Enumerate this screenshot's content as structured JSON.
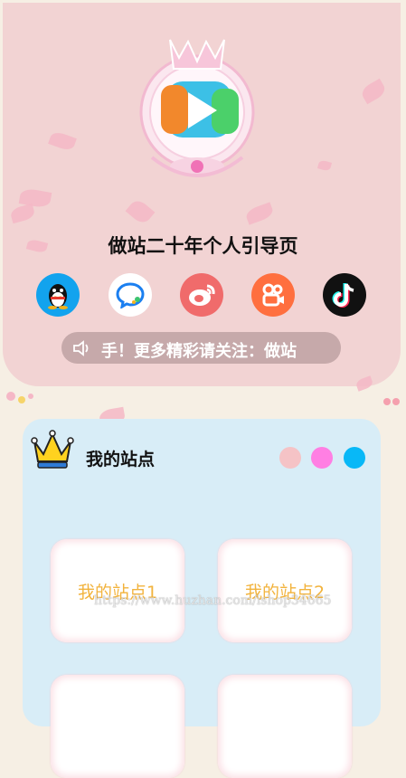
{
  "header": {
    "title": "做站二十年个人引导页",
    "logo_icon": "video-player-logo-icon"
  },
  "social": [
    {
      "name": "qq",
      "icon": "qq-penguin-icon",
      "color": "#12a3ee"
    },
    {
      "name": "chat",
      "icon": "chat-bubble-icon",
      "color": "#ffffff"
    },
    {
      "name": "weibo",
      "icon": "weibo-icon",
      "color": "#f06b6b"
    },
    {
      "name": "kuaishou",
      "icon": "kuaishou-camera-icon",
      "color": "#ff6f3f"
    },
    {
      "name": "tiktok",
      "icon": "tiktok-note-icon",
      "color": "#111111"
    }
  ],
  "notice": {
    "icon": "speaker-icon",
    "text": "手！更多精彩请关注：做站"
  },
  "sites": {
    "title": "我的站点",
    "crown_icon": "crown-icon",
    "theme_dots": [
      "#f5c3c6",
      "#ff7fe3",
      "#08b8f7"
    ],
    "items": [
      "我的站点1",
      "我的站点2",
      "",
      ""
    ]
  },
  "watermark": "https://www.huzhan.com/ishop34665",
  "colors": {
    "hero_bg": "#f2d3d3",
    "page_bg": "#f6efe4",
    "card_bg": "#d8edf7",
    "site_label": "#f2b33d"
  }
}
